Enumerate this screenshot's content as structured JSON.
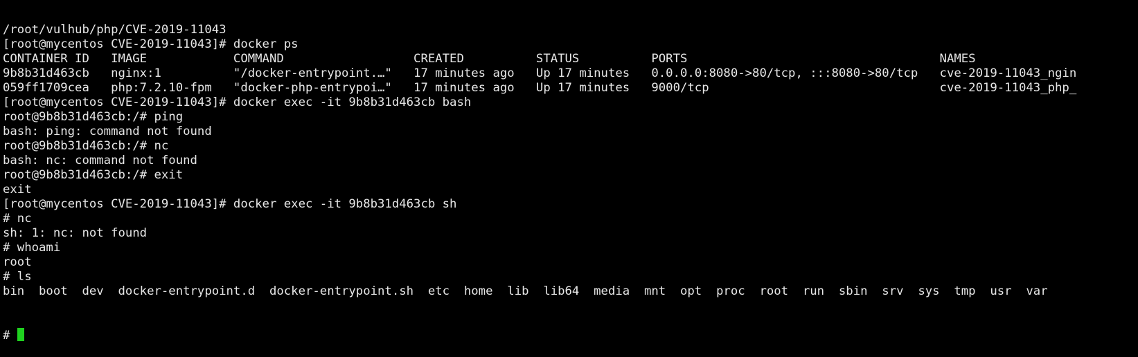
{
  "terminal": {
    "cursor_color": "#1fd11f",
    "lines": [
      "/root/vulhub/php/CVE-2019-11043",
      "[root@mycentos CVE-2019-11043]# docker ps",
      "CONTAINER ID   IMAGE            COMMAND                  CREATED          STATUS          PORTS                                   NAMES",
      "9b8b31d463cb   nginx:1          \"/docker-entrypoint.…\"   17 minutes ago   Up 17 minutes   0.0.0.0:8080->80/tcp, :::8080->80/tcp   cve-2019-11043_ngin",
      "059ff1709cea   php:7.2.10-fpm   \"docker-php-entrypoi…\"   17 minutes ago   Up 17 minutes   9000/tcp                                cve-2019-11043_php_",
      "[root@mycentos CVE-2019-11043]# docker exec -it 9b8b31d463cb bash",
      "root@9b8b31d463cb:/# ping",
      "bash: ping: command not found",
      "root@9b8b31d463cb:/# nc",
      "bash: nc: command not found",
      "root@9b8b31d463cb:/# exit",
      "exit",
      "[root@mycentos CVE-2019-11043]# docker exec -it 9b8b31d463cb sh",
      "# nc",
      "sh: 1: nc: not found",
      "# whoami",
      "root",
      "# ls",
      "bin  boot  dev  docker-entrypoint.d  docker-entrypoint.sh  etc  home  lib  lib64  media  mnt  opt  proc  root  run  sbin  srv  sys  tmp  usr  var"
    ],
    "prompt": "# "
  }
}
